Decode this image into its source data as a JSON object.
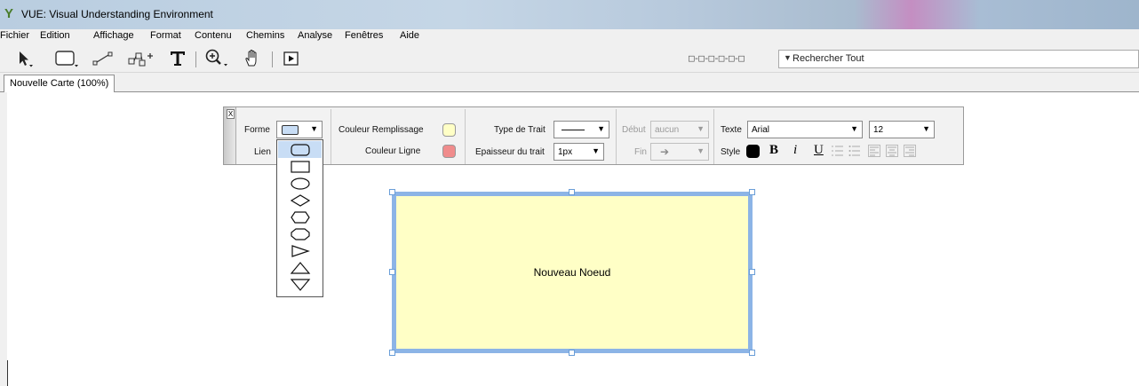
{
  "window": {
    "title": "VUE: Visual Understanding Environment",
    "icon": "vue-logo-icon"
  },
  "menu": [
    "Fichier",
    "Edition",
    "Affichage",
    "Format",
    "Contenu",
    "Chemins",
    "Analyse",
    "Fenêtres",
    "Aide"
  ],
  "toolbar": {
    "tools": [
      "selection-arrow-icon",
      "node-rectangle-icon",
      "link-tool-icon",
      "ontology-link-icon",
      "text-tool-icon",
      "zoom-tool-icon",
      "hand-pan-icon",
      "presentation-play-icon"
    ],
    "search_placeholder": "Rechercher Tout"
  },
  "tab": {
    "label": "Nouvelle Carte (100%)"
  },
  "format_panel": {
    "close_label": "X",
    "forme_label": "Forme",
    "lien_label": "Lien",
    "fill_label": "Couleur Remplissage",
    "fill_color": "#ffffc6",
    "line_color_label": "Couleur Ligne",
    "line_color": "#f08c8c",
    "stroke_type_label": "Type de Trait",
    "stroke_width_label": "Epaisseur du trait",
    "stroke_width_value": "1px",
    "start_label": "Début",
    "start_value": "aucun",
    "end_label": "Fin",
    "text_label": "Texte",
    "font_value": "Arial",
    "size_value": "12",
    "style_label": "Style",
    "style_color": "#000000",
    "bold_glyph": "B",
    "italic_glyph": "i",
    "underline_glyph": "U"
  },
  "shape_menu": {
    "selected": "rounded-rectangle",
    "items": [
      "rounded-rectangle",
      "rectangle",
      "ellipse",
      "diamond",
      "hexagon",
      "octagon",
      "triangle-right",
      "triangle-up",
      "triangle-down"
    ]
  },
  "node": {
    "label": "Nouveau Noeud",
    "fill": "#ffffc6",
    "border": "#8cb4e6"
  }
}
